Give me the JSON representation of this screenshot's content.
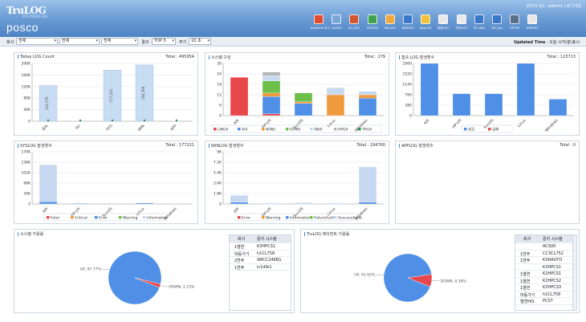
{
  "header": {
    "logo_top": "TruLOG",
    "logo_sub": "STS TRACE LOG",
    "logo_bottom": "posco",
    "user_info": "관리자 (ID : admin) | 로그아웃",
    "nav": [
      {
        "label": "Realtime 로그",
        "icon": "realtime-icon",
        "color": "#e24c2f"
      },
      {
        "label": "SyslOG",
        "icon": "syslog-icon",
        "color": "#7aa6d8"
      },
      {
        "label": "Su_LOG",
        "icon": "sulog-icon",
        "color": "#d3562f"
      },
      {
        "label": "SYSLOG",
        "icon": "syslog-doc-icon",
        "color": "#3fa34d"
      },
      {
        "label": "WinLOG",
        "icon": "winlog-icon",
        "color": "#f2a93b"
      },
      {
        "label": "WINLOG",
        "icon": "winlog-doc-icon",
        "color": "#3b77c9"
      },
      {
        "label": "AppLOG",
        "icon": "applog-icon",
        "color": "#f2c23b"
      },
      {
        "label": "통합LOG",
        "icon": "total-log-icon",
        "color": "#e8e8e8"
      },
      {
        "label": "변경LOG",
        "icon": "change-log-icon",
        "color": "#e8e8e8"
      },
      {
        "label": "RT view",
        "icon": "monitor-icon",
        "color": "#3b77c9"
      },
      {
        "label": "HA_Sys",
        "icon": "ha-icon",
        "color": "#3b77c9"
      },
      {
        "label": "SETUP",
        "icon": "setup-icon",
        "color": "#5a6f8a"
      },
      {
        "label": "REPORT",
        "icon": "report-icon",
        "color": "#e8e8e8"
      }
    ]
  },
  "filter": {
    "company_label": "회사",
    "company_value": "전체",
    "select2_value": "전체",
    "select3_value": "전체",
    "grade_label": "결과",
    "grade_value": "TOP 5",
    "period_label": "주기",
    "period_value": "10 초",
    "updated_label": "Updated Time",
    "updated_value": ": 오늘 시각(분)표시"
  },
  "panels": {
    "today": {
      "title": "Today LOG Count",
      "total": "Total : 495954"
    },
    "system": {
      "title": "시스템 구성",
      "total": "Total : 179"
    },
    "access": {
      "title": "접속 LOG 발생횟수",
      "total": "Total : 123713"
    },
    "syslog": {
      "title": "SYSLOG 발생횟수",
      "total": "Total : 177221"
    },
    "winlog": {
      "title": "WINLOG 발생횟수",
      "total": "Total : 194760"
    },
    "applog": {
      "title": "APPLOG 발생횟수",
      "total": "Total : 0"
    },
    "availability": {
      "title": "시스템 가용률"
    },
    "agent": {
      "title": "TruLOG 에이전트 가용률"
    }
  },
  "chart_data": [
    {
      "type": "bar",
      "title": "Today LOG Count",
      "categories": [
        "접속",
        "SU",
        "SYS",
        "WIN",
        "APP"
      ],
      "values": [
        123770,
        0,
        177221,
        194760,
        0
      ],
      "value_labels": [
        "123,770",
        "",
        "177,221",
        "194,760",
        ""
      ],
      "ytick_labels": [
        "0",
        "40K",
        "80K",
        "120K",
        "160K",
        "200K"
      ],
      "ylim": [
        0,
        200000
      ]
    },
    {
      "type": "bar",
      "stacked": true,
      "title": "시스템 구성",
      "categories": [
        "AIX",
        "HP-UX",
        "SunOS",
        "Linux",
        "Windows"
      ],
      "series": [
        {
          "name": "LINUX",
          "color": "#e8474c",
          "values": [
            22,
            1,
            0,
            0,
            0
          ]
        },
        {
          "name": "AIX",
          "color": "#4f8fe6",
          "values": [
            0,
            10,
            7,
            0,
            10
          ]
        },
        {
          "name": "WINS",
          "color": "#f09a3e",
          "values": [
            0,
            2,
            1,
            12,
            2
          ]
        },
        {
          "name": "OVMS",
          "color": "#6cc04a",
          "values": [
            0,
            7,
            5,
            0,
            0
          ]
        },
        {
          "name": "SNIX",
          "color": "#c8d8f0",
          "values": [
            0,
            3,
            0,
            4,
            2
          ]
        },
        {
          "name": "HPUX",
          "color": "#b5b5b5",
          "values": [
            0,
            2,
            0,
            0,
            0
          ]
        },
        {
          "name": "TRUX",
          "color": "#2e8b57",
          "values": [
            0,
            0,
            0,
            0,
            0
          ]
        }
      ],
      "ytick_labels": [
        "0",
        "6",
        "12",
        "18",
        "24",
        "30"
      ],
      "ylim": [
        0,
        30
      ]
    },
    {
      "type": "bar",
      "stacked": true,
      "title": "접속 LOG 발생횟수",
      "categories": [
        "AIX",
        "HP-UX",
        "SunOS",
        "Linux",
        "Windows"
      ],
      "series": [
        {
          "name": "성공",
          "color": "#4f8fe6",
          "values": [
            2200,
            800,
            800,
            3200,
            600
          ]
        },
        {
          "name": "실패",
          "color": "#e8474c",
          "values": [
            0,
            0,
            0,
            102200,
            0
          ]
        }
      ],
      "ytick_labels": [
        "0",
        "380",
        "760",
        "1140",
        "1520",
        "1900"
      ],
      "ylim": [
        0,
        1900
      ]
    },
    {
      "type": "bar",
      "stacked": true,
      "title": "SYSLOG 발생횟수",
      "categories": [
        "AIX",
        "HP-UX",
        "SunOS",
        "Linux",
        "Windows"
      ],
      "series": [
        {
          "name": "Fatal",
          "color": "#e8474c",
          "values": [
            0,
            0,
            0,
            0,
            0
          ]
        },
        {
          "name": "Critical",
          "color": "#f09a3e",
          "values": [
            0,
            0,
            0,
            0,
            0
          ]
        },
        {
          "name": "Error",
          "color": "#4f8fe6",
          "values": [
            7000,
            2000,
            500,
            3000,
            0
          ]
        },
        {
          "name": "Warning",
          "color": "#6cc04a",
          "values": [
            0,
            0,
            0,
            0,
            0
          ]
        },
        {
          "name": "Information",
          "color": "#c8d8f0",
          "values": [
            121000,
            0,
            0,
            0,
            0
          ]
        }
      ],
      "ytick_labels": [
        "0",
        "34K",
        "68K",
        "102K",
        "136K",
        "170K"
      ],
      "ylim": [
        0,
        170000
      ]
    },
    {
      "type": "bar",
      "stacked": true,
      "title": "WINLOG 발생횟수",
      "categories": [
        "AIX",
        "HP-UX",
        "SunOS",
        "Linux",
        "Windows"
      ],
      "series": [
        {
          "name": "Error",
          "color": "#e8474c",
          "values": [
            0,
            0,
            0,
            0,
            0
          ]
        },
        {
          "name": "Warning",
          "color": "#f09a3e",
          "values": [
            0,
            0,
            0,
            0,
            0
          ]
        },
        {
          "name": "Information",
          "color": "#4f8fe6",
          "values": [
            300,
            0,
            0,
            0,
            300
          ]
        },
        {
          "name": "FailureAudit",
          "color": "#6cc04a",
          "values": [
            0,
            0,
            0,
            0,
            0
          ]
        },
        {
          "name": "SuccessAudit",
          "color": "#c8d8f0",
          "values": [
            1200,
            150,
            250,
            150,
            6100
          ]
        }
      ],
      "ytick_labels": [
        "0",
        "1.8K",
        "3.6K",
        "5.4K",
        "7.2K",
        "9K"
      ],
      "ylim": [
        0,
        9000
      ]
    },
    {
      "type": "pie",
      "title": "시스템 가용률",
      "slices": [
        {
          "label": "UP, 97.77%",
          "value": 97.77,
          "color": "#4f8fe6"
        },
        {
          "label": "DOWN, 2.23%",
          "value": 2.23,
          "color": "#e8474c"
        }
      ]
    },
    {
      "type": "pie",
      "title": "TruLOG 에이전트 가용률",
      "slices": [
        {
          "label": "UP, 91.62%",
          "value": 91.62,
          "color": "#4f8fe6"
        },
        {
          "label": "DOWN, 8.38%",
          "value": 8.38,
          "color": "#e8474c"
        }
      ]
    }
  ],
  "table1": {
    "headers": [
      "회사",
      "중지 시스템"
    ],
    "rows": [
      [
        "1열연",
        "K3HPCS1"
      ],
      [
        "마동가기",
        "h1CL758"
      ],
      [
        "2연주",
        "SMCC24EB1"
      ],
      [
        "1연주",
        "ic1dfe1"
      ]
    ]
  },
  "table2": {
    "headers": [
      "회사",
      "중지 시스템"
    ],
    "rows": [
      [
        "",
        "ACS00"
      ],
      [
        "1연주",
        "CC3CL752"
      ],
      [
        "1연주",
        "K3HAUTO"
      ],
      [
        "",
        "K3HPCS1"
      ],
      [
        "1열연",
        "K2HPCS1"
      ],
      [
        "1열연",
        "K2HPCS2"
      ],
      [
        "1열연",
        "K3HPCS3"
      ],
      [
        "마동가기",
        "h1CL758"
      ],
      [
        "열연HiS",
        "PCS7"
      ]
    ]
  }
}
